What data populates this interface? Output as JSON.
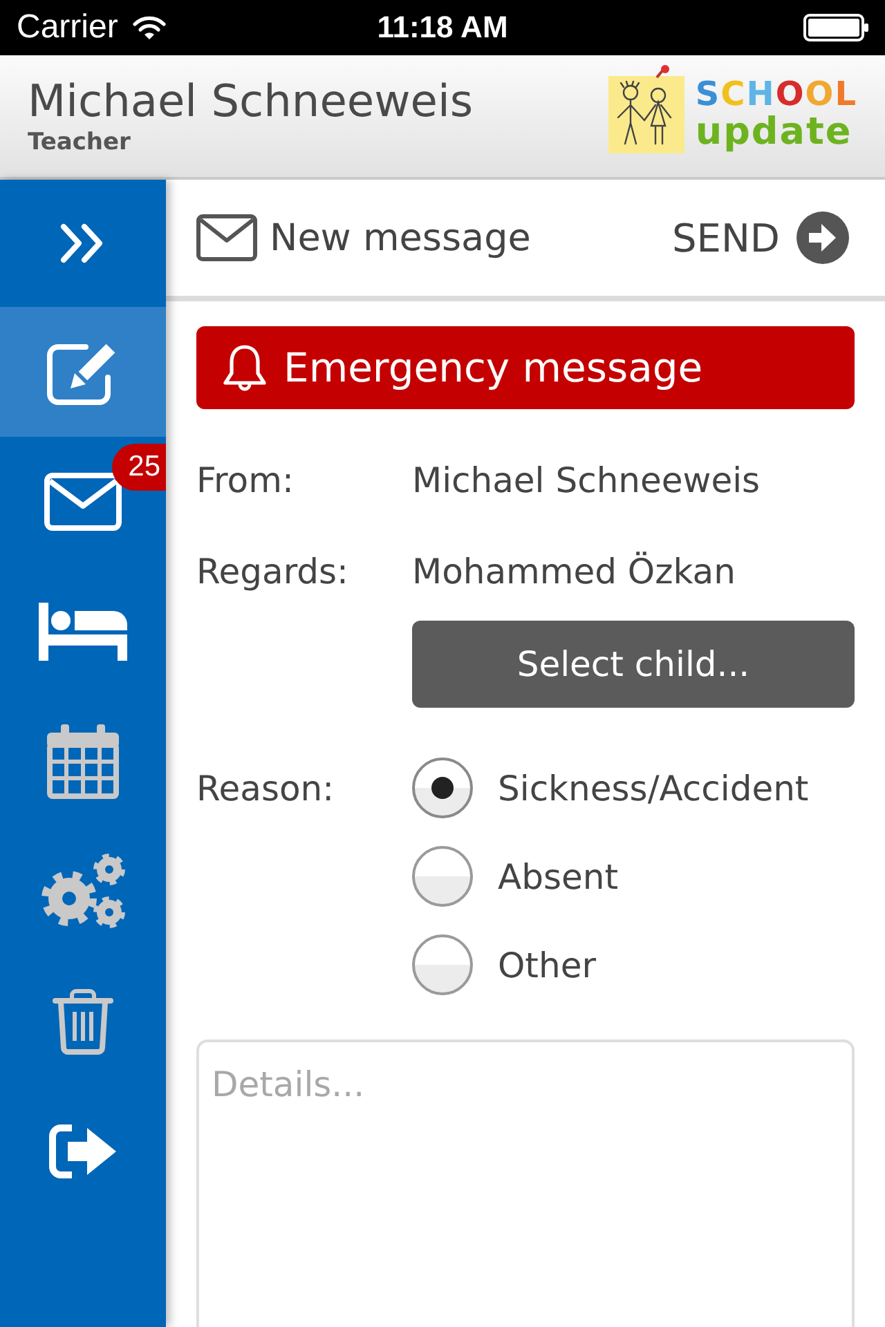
{
  "status_bar": {
    "carrier": "Carrier",
    "time": "11:18 AM"
  },
  "header": {
    "name": "Michael Schneeweis",
    "role": "Teacher",
    "logo": {
      "line_1": "SCHOOL",
      "line_2": "update"
    }
  },
  "sidebar": {
    "items": [
      {
        "kind": "expand",
        "selected": false,
        "disabled": false
      },
      {
        "kind": "compose",
        "selected": true,
        "disabled": false
      },
      {
        "kind": "mail",
        "selected": false,
        "disabled": false,
        "badge": "25"
      },
      {
        "kind": "bed",
        "selected": false,
        "disabled": false
      },
      {
        "kind": "calendar",
        "selected": false,
        "disabled": true
      },
      {
        "kind": "settings",
        "selected": false,
        "disabled": true
      },
      {
        "kind": "trash",
        "selected": false,
        "disabled": true
      },
      {
        "kind": "logout",
        "selected": false,
        "disabled": false
      }
    ]
  },
  "toolbar": {
    "title": "New message",
    "send": "SEND"
  },
  "emergency_button": {
    "label": "Emergency message"
  },
  "form": {
    "from": {
      "label": "From:",
      "value": "Michael Schneeweis"
    },
    "regards": {
      "label": "Regards:",
      "value": "Mohammed Özkan"
    },
    "select_button": "Select child...",
    "reason": {
      "label": "Reason:",
      "options": [
        {
          "label": "Sickness/Accident",
          "selected": true
        },
        {
          "label": "Absent",
          "selected": false
        },
        {
          "label": "Other",
          "selected": false
        }
      ]
    },
    "details": {
      "placeholder": "Details..."
    }
  }
}
